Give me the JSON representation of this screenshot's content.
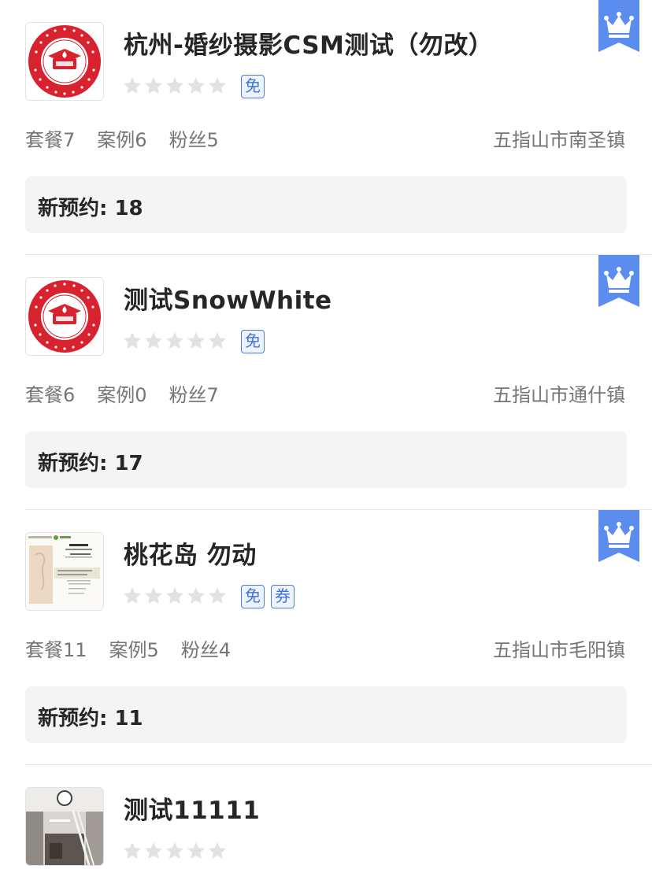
{
  "colors": {
    "accent": "#5b8def",
    "tag_border": "#4a7fe0",
    "star_empty": "#e2e2e2",
    "logo_red": "#d8222f",
    "booking_bg": "#f4f4f4"
  },
  "icons": {
    "vip": "crown-icon",
    "rating": "star-icon"
  },
  "labels": {
    "package": "套餐",
    "cases": "案例",
    "fans": "粉丝",
    "new_booking": "新预约: "
  },
  "stores": [
    {
      "name": "杭州-婚纱摄影CSM测试（勿改）",
      "logo": "rhino-college-logo",
      "rating": 0,
      "tags": [
        "免"
      ],
      "stat_package": "套餐7",
      "stat_cases": "案例6",
      "stat_fans": "粉丝5",
      "location": "五指山市南圣镇",
      "new_booking": "新预约: 18",
      "vip": true
    },
    {
      "name": "测试SnowWhite",
      "logo": "rhino-college-logo",
      "rating": 0,
      "tags": [
        "免"
      ],
      "stat_package": "套餐6",
      "stat_cases": "案例0",
      "stat_fans": "粉丝7",
      "location": "五指山市通什镇",
      "new_booking": "新预约: 17",
      "vip": true
    },
    {
      "name": "桃花岛 勿动",
      "logo": "wedding-service-card-logo",
      "rating": 0,
      "tags": [
        "免",
        "券"
      ],
      "stat_package": "套餐11",
      "stat_cases": "案例5",
      "stat_fans": "粉丝4",
      "location": "五指山市毛阳镇",
      "new_booking": "新预约: 11",
      "vip": true
    },
    {
      "name": "测试11111",
      "logo": "interior-photo-logo",
      "rating": 0,
      "tags": [],
      "vip": false
    }
  ]
}
